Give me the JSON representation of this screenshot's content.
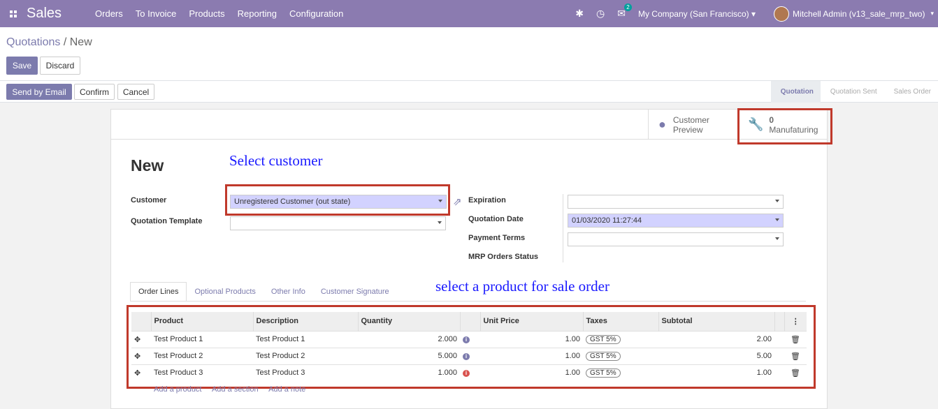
{
  "nav": {
    "app": "Sales",
    "menu": [
      "Orders",
      "To Invoice",
      "Products",
      "Reporting",
      "Configuration"
    ],
    "chat_count": "2",
    "company": "My Company (San Francisco)",
    "user": "Mitchell Admin (v13_sale_mrp_two)"
  },
  "breadcrumb": {
    "parent": "Quotations",
    "sep": " / ",
    "current": "New"
  },
  "actions": {
    "save": "Save",
    "discard": "Discard"
  },
  "status_buttons": {
    "send": "Send by Email",
    "confirm": "Confirm",
    "cancel": "Cancel"
  },
  "stages": [
    "Quotation",
    "Quotation Sent",
    "Sales Order"
  ],
  "smart_buttons": {
    "preview_line1": "Customer",
    "preview_line2": "Preview",
    "mfg_count": "0",
    "mfg_label": "Manufaturing"
  },
  "form": {
    "title": "New",
    "annotation_customer": "Select customer",
    "annotation_product": "select a product for sale order",
    "customer_label": "Customer",
    "customer_value": "Unregistered Customer (out state)",
    "template_label": "Quotation Template",
    "template_value": "",
    "expiration_label": "Expiration",
    "expiration_value": "",
    "quote_date_label": "Quotation Date",
    "quote_date_value": "01/03/2020 11:27:44",
    "payment_label": "Payment Terms",
    "payment_value": "",
    "mrp_label": "MRP Orders Status"
  },
  "tabs": [
    "Order Lines",
    "Optional Products",
    "Other Info",
    "Customer Signature"
  ],
  "lines": {
    "headers": [
      "Product",
      "Description",
      "Quantity",
      "Unit Price",
      "Taxes",
      "Subtotal"
    ],
    "rows": [
      {
        "product": "Test Product 1",
        "description": "Test Product 1",
        "qty": "2.000",
        "price": "1.00",
        "tax": "GST 5%",
        "subtotal": "2.00",
        "warn": false
      },
      {
        "product": "Test Product 2",
        "description": "Test Product 2",
        "qty": "5.000",
        "price": "1.00",
        "tax": "GST 5%",
        "subtotal": "5.00",
        "warn": false
      },
      {
        "product": "Test Product 3",
        "description": "Test Product 3",
        "qty": "1.000",
        "price": "1.00",
        "tax": "GST 5%",
        "subtotal": "1.00",
        "warn": true
      }
    ],
    "add_links": [
      "Add a product",
      "Add a section",
      "Add a note"
    ]
  },
  "colors": {
    "navbar": "#8b7bb0",
    "primary": "#7c7bad",
    "annotation": "#1a1aff",
    "highlight_box": "#c0392b"
  }
}
